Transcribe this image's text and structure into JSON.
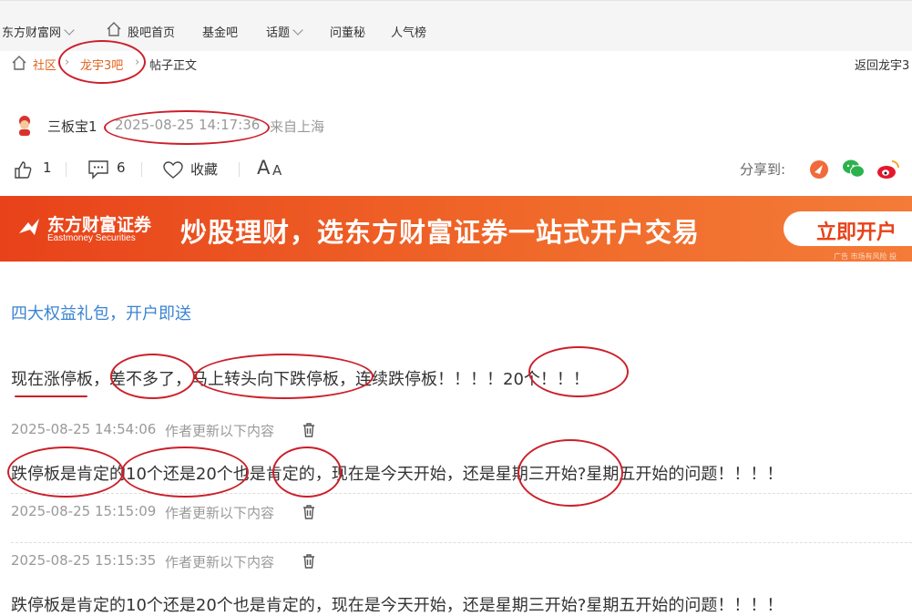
{
  "nav": {
    "items": [
      "东方财富网",
      "股吧首页",
      "基金吧",
      "话题",
      "问董秘",
      "人气榜"
    ]
  },
  "breadcrumb": {
    "community": "社区",
    "bar": "龙宇3吧",
    "current": "帖子正文",
    "back": "返回龙宇3"
  },
  "author": {
    "name": "三板宝1",
    "time": "2025-08-25 14:17:36",
    "location": "来自上海"
  },
  "actions": {
    "likes": "1",
    "comments": "6",
    "favorite": "收藏",
    "font_size": "A",
    "font_size_small": "A",
    "share_label": "分享到:"
  },
  "banner": {
    "brand": "东方财富证券",
    "brand_en": "Eastmoney Securities",
    "slogan": "炒股理财，选东方财富证券一站式开户交易",
    "cta": "立即开户",
    "ad_tag": "广告 市场有风险 投"
  },
  "post": {
    "promo_link": "四大权益礼包，开户即送",
    "body": "现在涨停板，差不多了，马上转头向下跌停板，连续跌停板！！！！20个！！！",
    "updates": [
      {
        "time": "2025-08-25 14:54:06",
        "label": "作者更新以下内容",
        "text": "跌停板是肯定的10个还是20个也是肯定的，现在是今天开始，还是星期三开始?星期五开始的问题！！！！"
      },
      {
        "time": "2025-08-25 15:15:09",
        "label": "作者更新以下内容",
        "text": ""
      },
      {
        "time": "2025-08-25 15:15:35",
        "label": "作者更新以下内容",
        "text": "跌停板是肯定的10个还是20个也是肯定的，现在是今天开始，还是星期三开始?星期五开始的问题！！！！"
      }
    ]
  },
  "colors": {
    "accent": "#e0631e",
    "link": "#3a84d2",
    "annotation": "#cc1f2a",
    "banner": "#e8421a"
  }
}
